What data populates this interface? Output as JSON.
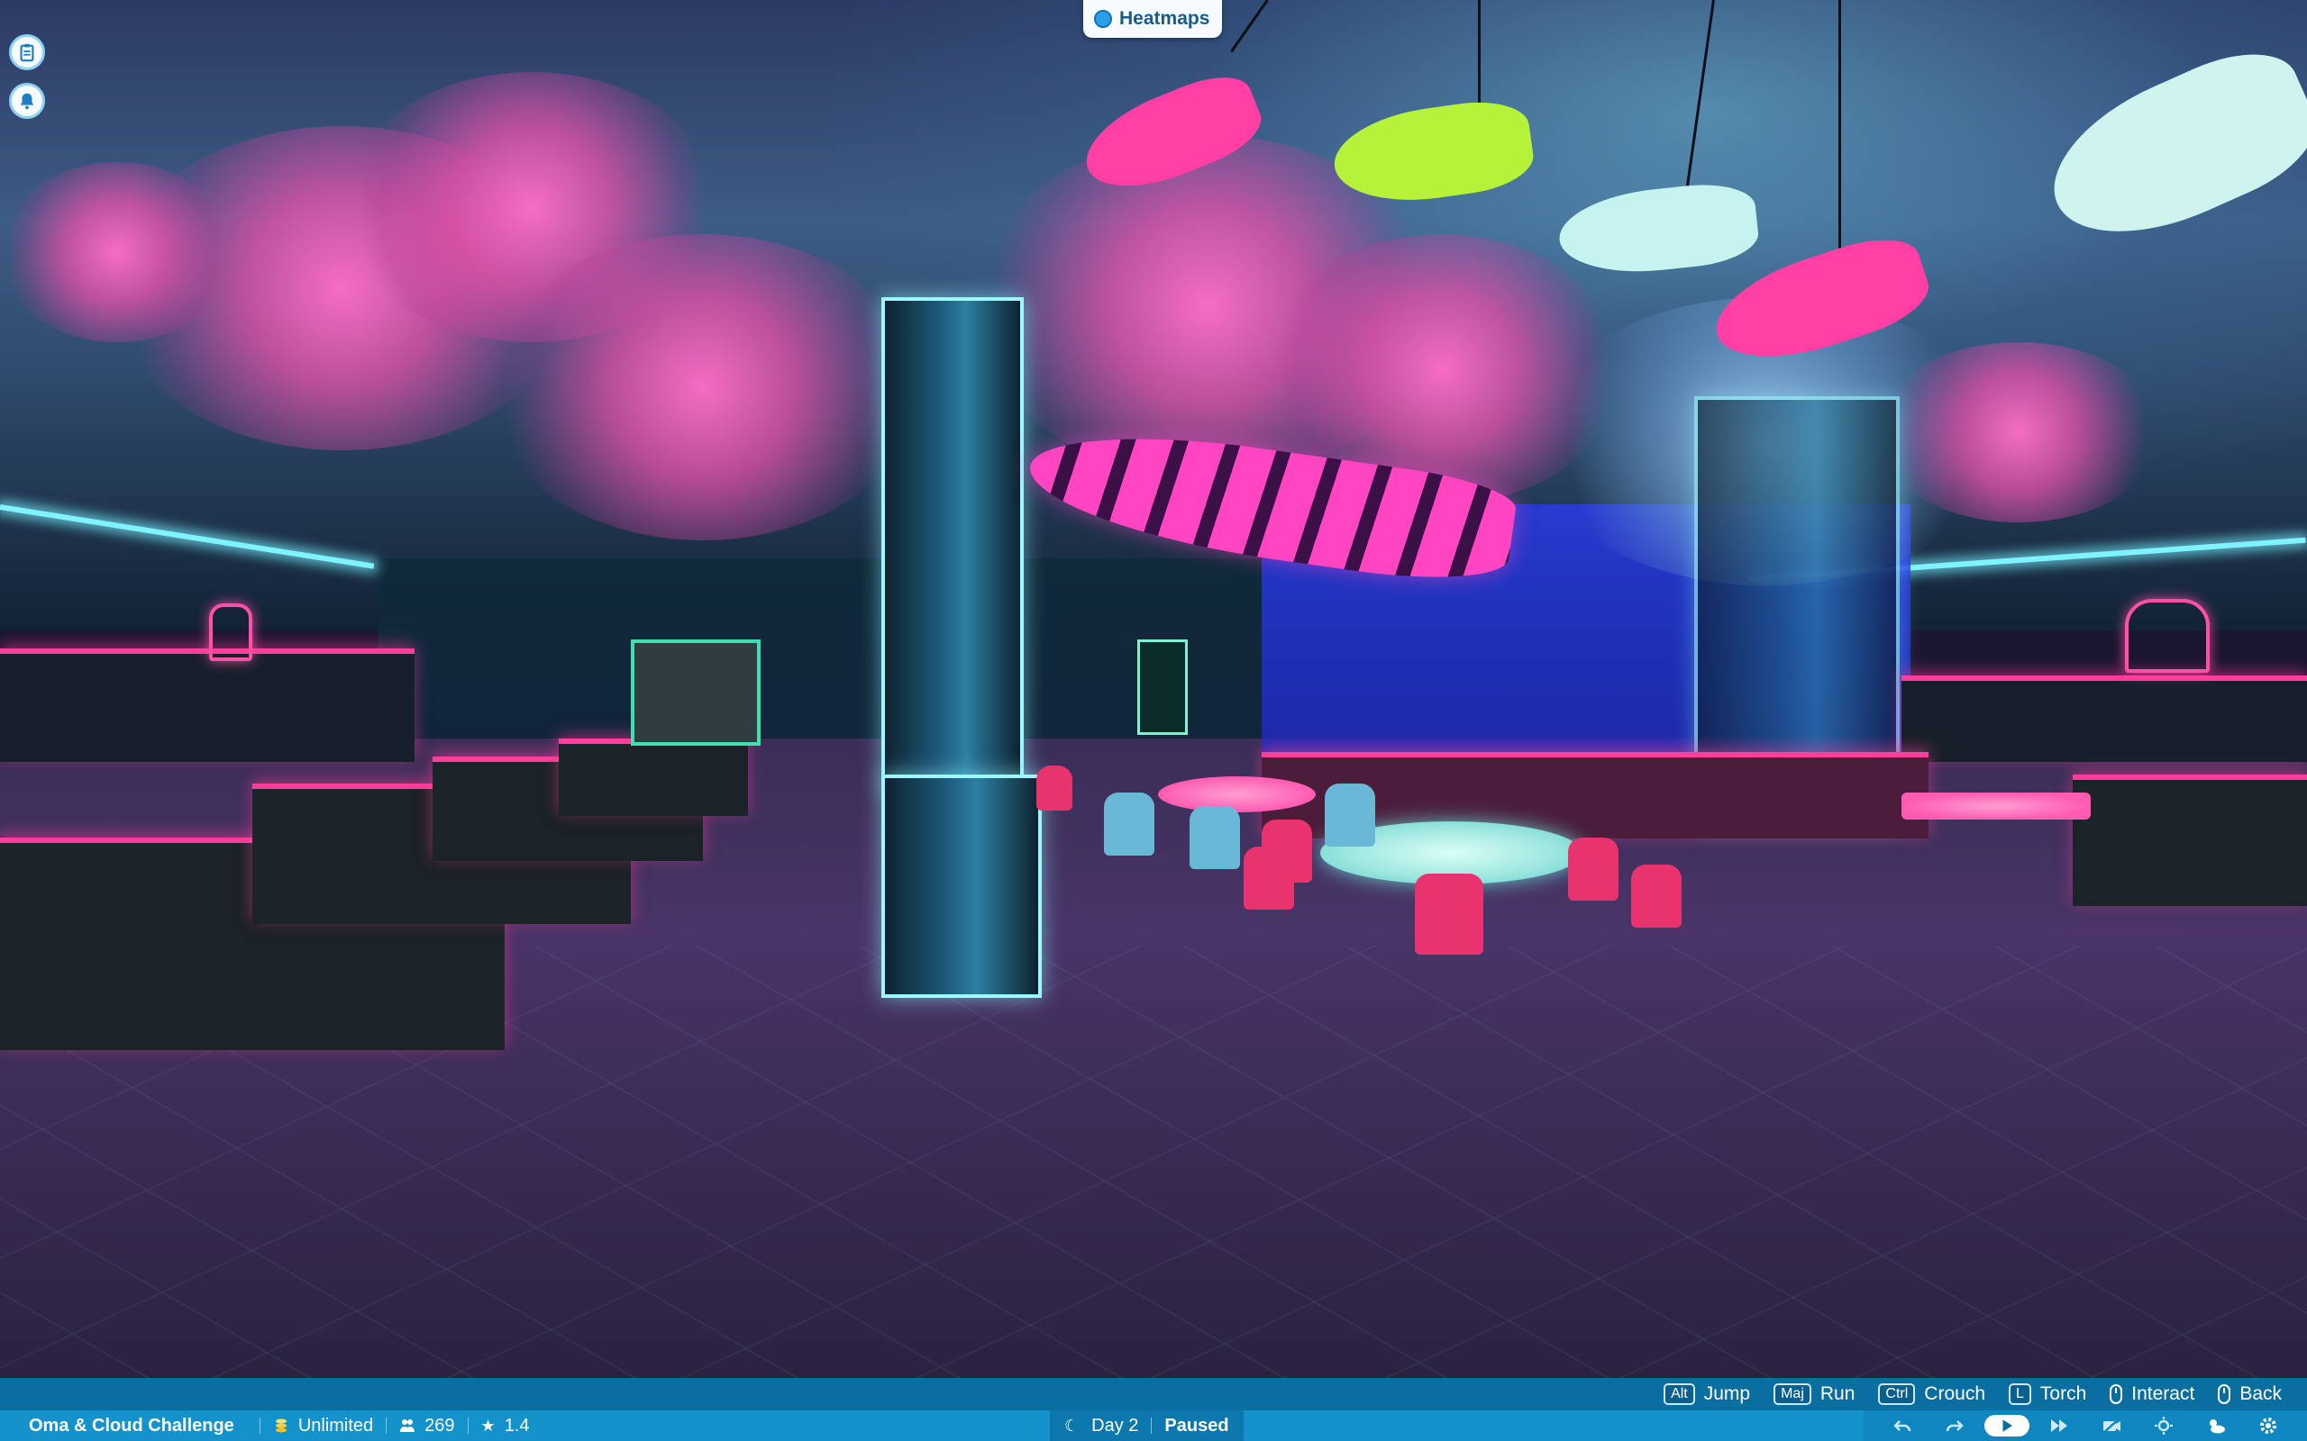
{
  "top": {
    "heatmaps_label": "Heatmaps"
  },
  "controls": [
    {
      "key": "Alt",
      "label": "Jump"
    },
    {
      "key": "Maj",
      "label": "Run"
    },
    {
      "key": "Ctrl",
      "label": "Crouch"
    },
    {
      "key": "L",
      "label": "Torch"
    },
    {
      "key": "",
      "label": "Interact"
    },
    {
      "key": "",
      "label": "Back"
    }
  ],
  "status": {
    "park_name": "Oma & Cloud Challenge",
    "money": "Unlimited",
    "guests": "269",
    "rating": "1.4",
    "day": "Day 2",
    "sim_state": "Paused"
  },
  "colors": {
    "status_bar": "#1492cc",
    "controls_bar": "#0a6ea0",
    "neon_pink": "#ff3d9a",
    "neon_cyan": "#7ff3ff"
  },
  "icons": {
    "side": [
      "clipboard-icon",
      "bell-icon"
    ],
    "bottom_tools": [
      "undo-icon",
      "redo-icon",
      "play-icon",
      "fast-forward-icon",
      "camera-off-icon",
      "weather-icon",
      "cloud-sun-icon",
      "settings-icon"
    ]
  }
}
